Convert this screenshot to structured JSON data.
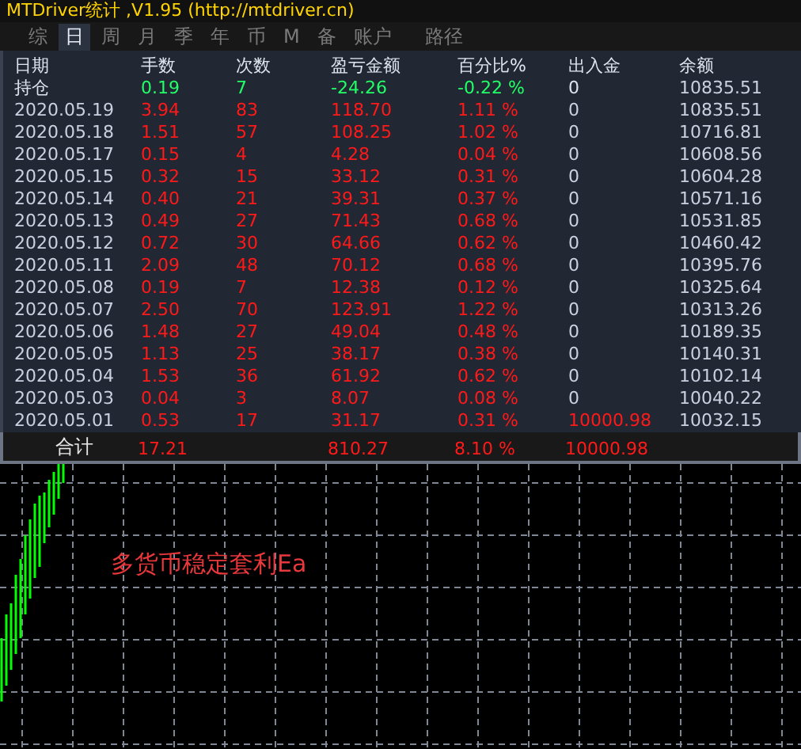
{
  "window": {
    "title": "MTDriver统计 ,V1.95 (http://mtdriver.cn)"
  },
  "tabs": [
    {
      "label": "综",
      "selected": false
    },
    {
      "label": "日",
      "selected": true
    },
    {
      "label": "周",
      "selected": false
    },
    {
      "label": "月",
      "selected": false
    },
    {
      "label": "季",
      "selected": false
    },
    {
      "label": "年",
      "selected": false
    },
    {
      "label": "币",
      "selected": false
    },
    {
      "label": "M",
      "selected": false
    },
    {
      "label": "备",
      "selected": false
    },
    {
      "label": "账户",
      "selected": false
    },
    {
      "label": "路径",
      "selected": false
    }
  ],
  "table": {
    "columns": [
      "日期",
      "手数",
      "次数",
      "盈亏金额",
      "百分比%",
      "出入金",
      "余额"
    ],
    "rows": [
      {
        "kind": "open",
        "cells": [
          "持仓",
          "0.19",
          "7",
          "-24.26",
          "-0.22 %",
          "0",
          "10835.51"
        ],
        "deposit_highlight": false
      },
      {
        "kind": "day",
        "cells": [
          "2020.05.19",
          "3.94",
          "83",
          "118.70",
          "1.11 %",
          "0",
          "10835.51"
        ],
        "deposit_highlight": false
      },
      {
        "kind": "day",
        "cells": [
          "2020.05.18",
          "1.51",
          "57",
          "108.25",
          "1.02 %",
          "0",
          "10716.81"
        ],
        "deposit_highlight": false
      },
      {
        "kind": "day",
        "cells": [
          "2020.05.17",
          "0.15",
          "4",
          "4.28",
          "0.04 %",
          "0",
          "10608.56"
        ],
        "deposit_highlight": false
      },
      {
        "kind": "day",
        "cells": [
          "2020.05.15",
          "0.32",
          "15",
          "33.12",
          "0.31 %",
          "0",
          "10604.28"
        ],
        "deposit_highlight": false
      },
      {
        "kind": "day",
        "cells": [
          "2020.05.14",
          "0.40",
          "21",
          "39.31",
          "0.37 %",
          "0",
          "10571.16"
        ],
        "deposit_highlight": false
      },
      {
        "kind": "day",
        "cells": [
          "2020.05.13",
          "0.49",
          "27",
          "71.43",
          "0.68 %",
          "0",
          "10531.85"
        ],
        "deposit_highlight": false
      },
      {
        "kind": "day",
        "cells": [
          "2020.05.12",
          "0.72",
          "30",
          "64.66",
          "0.62 %",
          "0",
          "10460.42"
        ],
        "deposit_highlight": false
      },
      {
        "kind": "day",
        "cells": [
          "2020.05.11",
          "2.09",
          "48",
          "70.12",
          "0.68 %",
          "0",
          "10395.76"
        ],
        "deposit_highlight": false
      },
      {
        "kind": "day",
        "cells": [
          "2020.05.08",
          "0.19",
          "7",
          "12.38",
          "0.12 %",
          "0",
          "10325.64"
        ],
        "deposit_highlight": false
      },
      {
        "kind": "day",
        "cells": [
          "2020.05.07",
          "2.50",
          "70",
          "123.91",
          "1.22 %",
          "0",
          "10313.26"
        ],
        "deposit_highlight": false
      },
      {
        "kind": "day",
        "cells": [
          "2020.05.06",
          "1.48",
          "27",
          "49.04",
          "0.48 %",
          "0",
          "10189.35"
        ],
        "deposit_highlight": false
      },
      {
        "kind": "day",
        "cells": [
          "2020.05.05",
          "1.13",
          "25",
          "38.17",
          "0.38 %",
          "0",
          "10140.31"
        ],
        "deposit_highlight": false
      },
      {
        "kind": "day",
        "cells": [
          "2020.05.04",
          "1.53",
          "36",
          "61.92",
          "0.62 %",
          "0",
          "10102.14"
        ],
        "deposit_highlight": false
      },
      {
        "kind": "day",
        "cells": [
          "2020.05.03",
          "0.04",
          "3",
          "8.07",
          "0.08 %",
          "0",
          "10040.22"
        ],
        "deposit_highlight": false
      },
      {
        "kind": "day",
        "cells": [
          "2020.05.01",
          "0.53",
          "17",
          "31.17",
          "0.31 %",
          "10000.98",
          "10032.15"
        ],
        "deposit_highlight": true
      }
    ],
    "total": {
      "label": "合计",
      "lots": "17.21",
      "profit": "810.27",
      "percent": "8.10 %",
      "deposit": "10000.98"
    }
  },
  "chart": {
    "caption": "多货币稳定套利Ea"
  }
}
